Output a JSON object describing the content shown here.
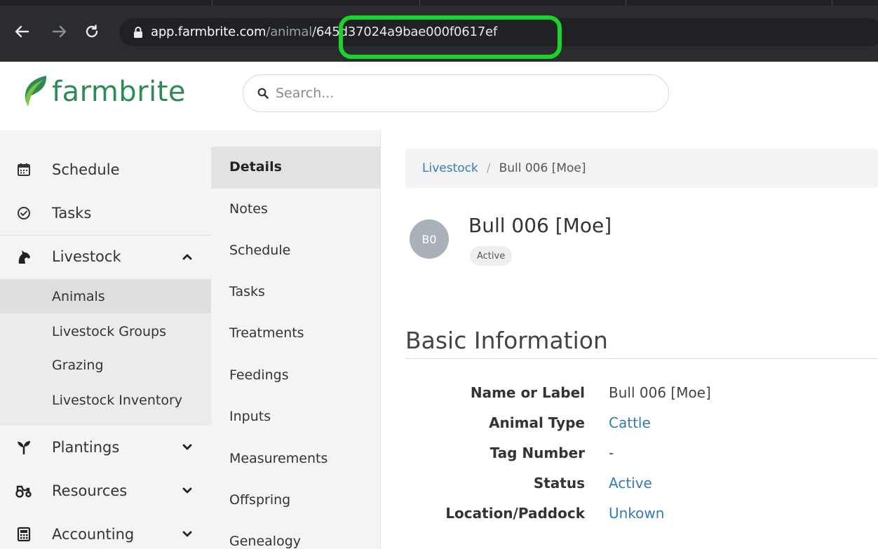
{
  "browser": {
    "url_host": "app.farmbrite.com",
    "url_path_visible": "/animal",
    "url_id": "/645d37024a9bae000f0617ef"
  },
  "header": {
    "logo_text": "farmbrite",
    "search_placeholder": "Search..."
  },
  "sidebar": {
    "items": [
      {
        "label": "Schedule",
        "icon": "calendar-icon"
      },
      {
        "label": "Tasks",
        "icon": "check-circle-icon"
      },
      {
        "label": "Livestock",
        "icon": "horse-icon",
        "expanded": true
      },
      {
        "label": "Plantings",
        "icon": "seedling-icon"
      },
      {
        "label": "Resources",
        "icon": "tractor-icon"
      },
      {
        "label": "Accounting",
        "icon": "calculator-icon"
      }
    ],
    "livestock_subitems": [
      "Animals",
      "Livestock Groups",
      "Grazing",
      "Livestock Inventory"
    ],
    "active_subitem": "Animals"
  },
  "subnav": {
    "items": [
      "Details",
      "Notes",
      "Schedule",
      "Tasks",
      "Treatments",
      "Feedings",
      "Inputs",
      "Measurements",
      "Offspring",
      "Genealogy"
    ],
    "active": "Details"
  },
  "breadcrumb": {
    "parent": "Livestock",
    "separator": "/",
    "current": "Bull 006 [Moe]"
  },
  "animal": {
    "avatar_initials": "B0",
    "name": "Bull 006 [Moe]",
    "status_badge": "Active"
  },
  "basic_info": {
    "title": "Basic Information",
    "rows": [
      {
        "key": "Name or Label",
        "value": "Bull 006 [Moe]",
        "link": false
      },
      {
        "key": "Animal Type",
        "value": "Cattle",
        "link": true
      },
      {
        "key": "Tag Number",
        "value": "-",
        "link": false
      },
      {
        "key": "Status",
        "value": "Active",
        "link": true
      },
      {
        "key": "Location/Paddock",
        "value": "Unkown",
        "link": true
      }
    ]
  },
  "colors": {
    "brand_green": "#2e8b57",
    "link_blue": "#337ab7",
    "highlight_green": "#1bd42b"
  }
}
